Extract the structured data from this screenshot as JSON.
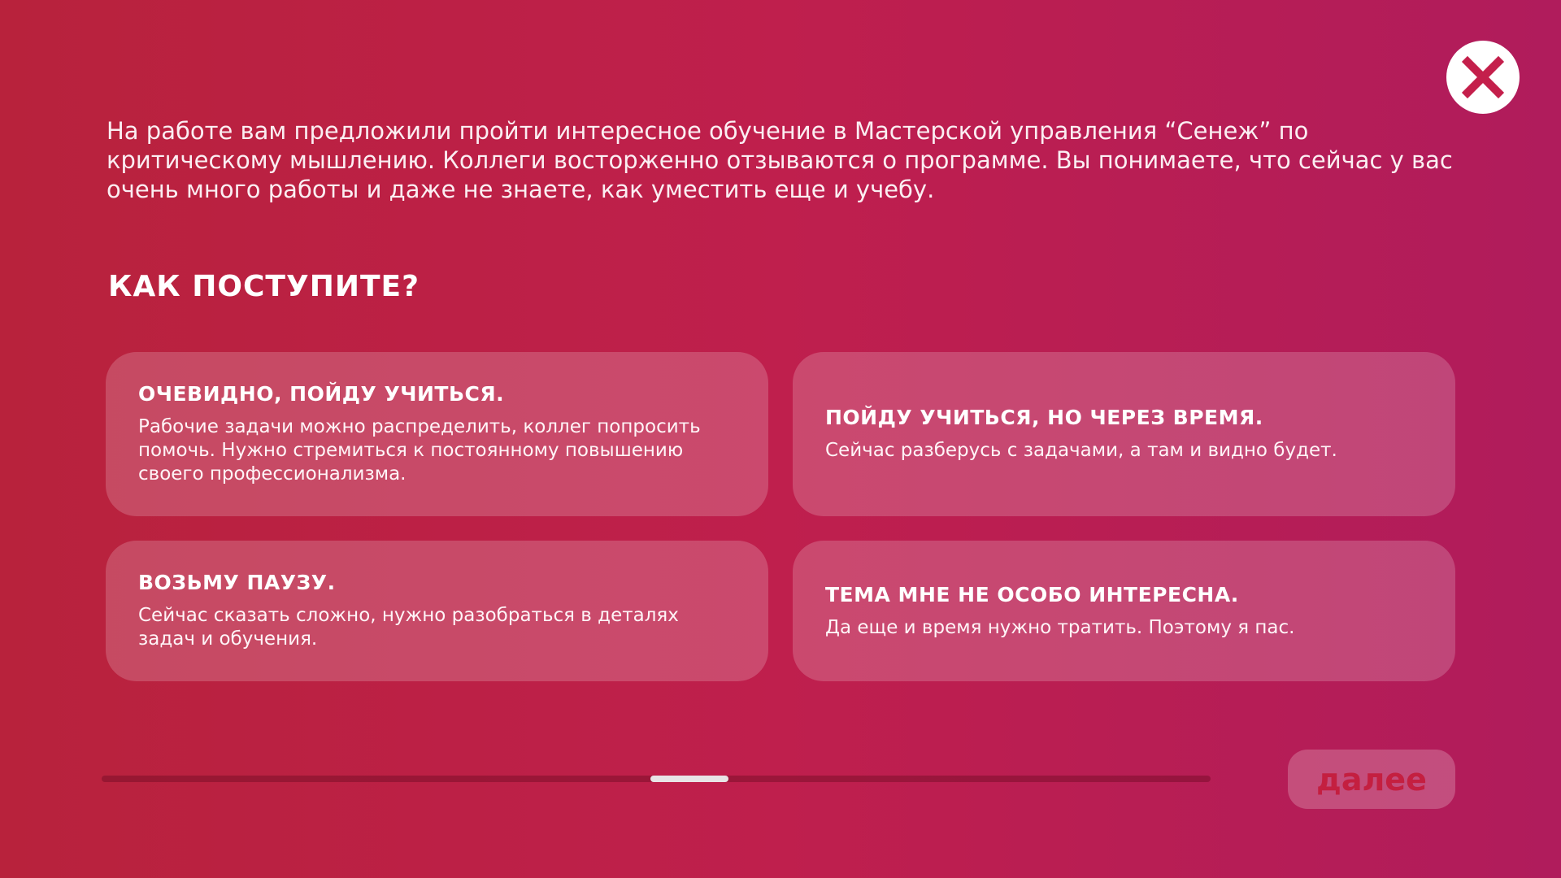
{
  "close_button": {
    "icon": "close-icon",
    "color": "#c41f4b"
  },
  "scenario_text": "На работе вам предложили пройти интересное обучение в Мастерской управления “Сенеж” по критическому мышлению. Коллеги восторженно отзываются о программе. Вы понимаете, что сейчас у вас очень много работы и даже не знаете, как уместить еще и учебу.",
  "question": "Как поступите?",
  "options": [
    {
      "title": "Очевидно, пойду учиться.",
      "description": "Рабочие задачи можно распределить, коллег попросить помочь. Нужно стремиться к постоянному повышению своего профессионализма."
    },
    {
      "title": "Пойду учиться, но через время.",
      "description": "Сейчас разберусь с задачами, а там и видно будет."
    },
    {
      "title": "Возьму паузу.",
      "description": "Сейчас сказать сложно, нужно разобраться в деталях задач и обучения."
    },
    {
      "title": "Тема мне не особо интересна.",
      "description": "Да еще и время нужно тратить. Поэтому я пас."
    }
  ],
  "progress": {
    "position": 0.53,
    "thumb_fraction": 0.07
  },
  "next_button": {
    "label": "далее",
    "enabled": false
  },
  "colors": {
    "background_start": "#b8223c",
    "background_end": "#b01c5c",
    "accent": "#c41f40"
  }
}
